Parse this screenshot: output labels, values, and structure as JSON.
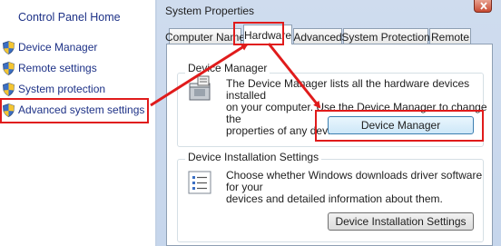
{
  "left_pane": {
    "home_link": "Control Panel Home",
    "links": [
      {
        "label": "Device Manager"
      },
      {
        "label": "Remote settings"
      },
      {
        "label": "System protection"
      },
      {
        "label": "Advanced system settings"
      }
    ]
  },
  "dialog": {
    "title": "System Properties",
    "tabs": [
      {
        "label": "Computer Name"
      },
      {
        "label": "Hardware"
      },
      {
        "label": "Advanced"
      },
      {
        "label": "System Protection"
      },
      {
        "label": "Remote"
      }
    ],
    "active_tab": "Hardware",
    "device_manager": {
      "group_title": "Device Manager",
      "description_lines": [
        "The Device Manager lists all the hardware devices installed",
        "on your computer. Use the Device Manager to change the",
        "properties of any device."
      ],
      "button_label": "Device Manager"
    },
    "device_installation": {
      "group_title": "Device Installation Settings",
      "description_lines": [
        "Choose whether Windows downloads driver software for your",
        "devices and detailed information about them."
      ],
      "button_label": "Device Installation Settings"
    }
  },
  "annotation_color": "#e01b1b",
  "link_color": "#1e3287",
  "icons": [
    "shield-icon",
    "device-manager-icon",
    "checklist-icon",
    "close-icon"
  ]
}
